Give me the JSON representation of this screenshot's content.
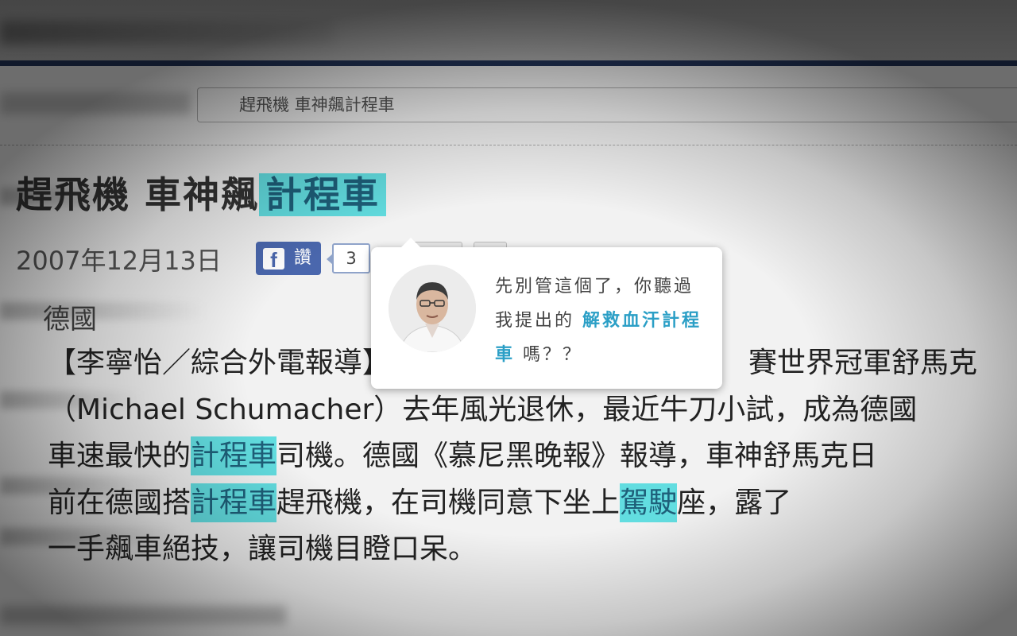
{
  "breadcrumb": {
    "text": "趕飛機 車神飆計程車"
  },
  "article": {
    "title_before": "趕飛機 車神飆",
    "title_highlight": "計程車",
    "date": "2007年12月13日",
    "location": "德國",
    "lines": [
      {
        "segments": [
          {
            "text": "【李寧怡／綜合外電報導】",
            "hl": false
          },
          {
            "text": "　　　　　　　　　　　　　賽世界冠軍舒馬克",
            "hl": false
          }
        ]
      },
      {
        "segments": [
          {
            "text": "（Michael Schumacher）去年風光退休，最近牛刀小試，成為德國",
            "hl": false
          }
        ]
      },
      {
        "segments": [
          {
            "text": "車速最快的",
            "hl": false
          },
          {
            "text": "計程車",
            "hl": true
          },
          {
            "text": "司機。德國《慕尼黑晚報》報導，車神舒馬克日",
            "hl": false
          }
        ]
      },
      {
        "segments": [
          {
            "text": "前在德國搭",
            "hl": false
          },
          {
            "text": "計程車",
            "hl": true
          },
          {
            "text": "趕飛機，在司機同意下坐上",
            "hl": false
          },
          {
            "text": "駕駛",
            "hl": true
          },
          {
            "text": "座，露了",
            "hl": false
          }
        ]
      },
      {
        "segments": [
          {
            "text": "一手飆車絕技，讓司機目瞪口呆。",
            "hl": false
          }
        ]
      }
    ]
  },
  "facebook": {
    "like_label": "讚",
    "icon_letter": "f",
    "count": "3"
  },
  "popup": {
    "text_before": "先別管這個了，你聽過我提出的 ",
    "link_text": "解救血汗計程車",
    "text_after": " 嗎？？",
    "avatar_icon": "person-portrait-icon"
  },
  "colors": {
    "highlight": "#62dde0",
    "link": "#2b9fc6",
    "fb": "#4a67ad",
    "nav": "#23355c"
  }
}
